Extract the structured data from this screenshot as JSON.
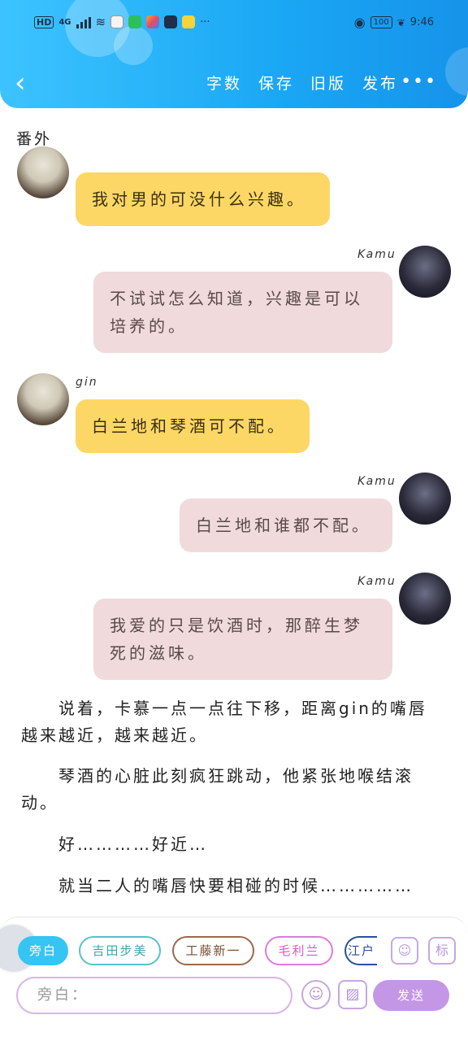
{
  "status_bar": {
    "hd": "HD",
    "network": "4G",
    "more": "···",
    "battery": "100",
    "time": "9:46"
  },
  "toolbar": {
    "back_icon": "chevron-left",
    "actions": [
      "字数",
      "保存",
      "旧版",
      "发布"
    ],
    "more": "•••"
  },
  "section_title": "番外",
  "messages": [
    {
      "speaker": "",
      "side": "left",
      "color": "yellow",
      "text": "我对男的可没什么兴趣。"
    },
    {
      "speaker": "Kamu",
      "side": "right",
      "color": "pink",
      "text": "不试试怎么知道，兴趣是可以培养的。"
    },
    {
      "speaker": "gin",
      "side": "left",
      "color": "yellow",
      "text": "白兰地和琴酒可不配。"
    },
    {
      "speaker": "Kamu",
      "side": "right",
      "color": "pink",
      "text": "白兰地和谁都不配。"
    },
    {
      "speaker": "Kamu",
      "side": "right",
      "color": "pink",
      "text": "我爱的只是饮酒时，那醉生梦死的滋味。"
    }
  ],
  "narration": [
    "　　说着，卡慕一点一点往下移，距离gin的嘴唇越来越近，越来越近。",
    "　　琴酒的心脏此刻疯狂跳动，他紧张地喉结滚动。",
    "　　好…………好近…",
    "　　就当二人的嘴唇快要相碰的时候……………"
  ],
  "roles": [
    {
      "label": "旁白",
      "active": true,
      "color": "#36c4f2"
    },
    {
      "label": "吉田步美",
      "active": false,
      "color": "#57c2c6"
    },
    {
      "label": "工藤新一",
      "active": false,
      "color": "#9b6a4c"
    },
    {
      "label": "毛利兰",
      "active": false,
      "color": "#e07ad8"
    },
    {
      "label": "江户",
      "active": false,
      "color": "#2b4f9a"
    }
  ],
  "side_buttons": {
    "role_icon": "person-card-icon",
    "tag": "标"
  },
  "composer": {
    "placeholder": "旁白：",
    "emoji_icon": "smiley-icon",
    "image_icon": "image-icon",
    "send_label": "发送"
  }
}
